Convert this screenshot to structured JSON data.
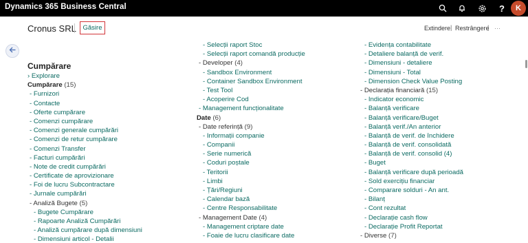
{
  "app": {
    "title": "Dynamics 365 Business Central",
    "avatar_initial": "K"
  },
  "topbar_icons": [
    "search-icon",
    "bell-icon",
    "gear-icon",
    "help-icon"
  ],
  "header": {
    "company": "Cronus SRL",
    "find_label": "Găsire",
    "expand_label": "Extindere",
    "collapse_label": "Restrângere",
    "more_label": "···",
    "separator": "|"
  },
  "colors": {
    "accent": "#0b6a62",
    "highlight_border": "#d13438",
    "topbar": "#000000",
    "avatar": "#c64b2c"
  },
  "col1": {
    "heading": "Cumpărare",
    "explore": "Explorare",
    "rows": [
      {
        "t": "Cumpărare",
        "c": " (15)",
        "k": "hdr",
        "i": 0
      },
      {
        "t": "- Furnizori",
        "k": "link",
        "i": 0
      },
      {
        "t": "- Contacte",
        "k": "link",
        "i": 0
      },
      {
        "t": "- Oferte cumpărare",
        "k": "link",
        "i": 0
      },
      {
        "t": "- Comenzi cumpărare",
        "k": "link",
        "i": 0
      },
      {
        "t": "- Comenzi generale cumpărări",
        "k": "link",
        "i": 0
      },
      {
        "t": "- Comenzi de retur cumpărare",
        "k": "link",
        "i": 0
      },
      {
        "t": "- Comenzi Transfer",
        "k": "link",
        "i": 0
      },
      {
        "t": "- Facturi cumpărări",
        "k": "link",
        "i": 0
      },
      {
        "t": "- Note de credit cumpărări",
        "k": "link",
        "i": 0
      },
      {
        "t": "- Certificate de aprovizionare",
        "k": "link",
        "i": 0
      },
      {
        "t": "- Foi de lucru Subcontractare",
        "k": "link",
        "i": 0
      },
      {
        "t": "- Jurnale cumpărări",
        "k": "link",
        "i": 0
      },
      {
        "t": "- Analiză Bugete",
        "c": " (5)",
        "k": "cat",
        "i": 0
      },
      {
        "t": "- Bugete Cumpărare",
        "k": "link",
        "i": 1
      },
      {
        "t": "- Rapoarte Analiză Cumpărări",
        "k": "link",
        "i": 1
      },
      {
        "t": "- Analiză cumpărare după dimensiuni",
        "k": "link",
        "i": 1
      },
      {
        "t": "- Dimensiuni articol - Detalii",
        "k": "link",
        "i": 1
      }
    ]
  },
  "col2": {
    "rows": [
      {
        "t": "- Selecții raport Stoc",
        "k": "link",
        "i": 1
      },
      {
        "t": "- Selecții raport comandă producție",
        "k": "link",
        "i": 1
      },
      {
        "t": "- Developer",
        "c": " (4)",
        "k": "cat",
        "i": 0
      },
      {
        "t": "- Sandbox Environment",
        "k": "link",
        "i": 1
      },
      {
        "t": "- Container Sandbox Environment",
        "k": "link",
        "i": 1
      },
      {
        "t": "- Test Tool",
        "k": "link",
        "i": 1
      },
      {
        "t": "- Acoperire Cod",
        "k": "link",
        "i": 1
      },
      {
        "t": "- Management funcționalitate",
        "k": "link",
        "i": 0
      },
      {
        "t": "Date",
        "c": " (6)",
        "k": "hdr",
        "i": 0
      },
      {
        "t": "- Date referință",
        "c": " (9)",
        "k": "cat",
        "i": 0
      },
      {
        "t": "- Informații companie",
        "k": "link",
        "i": 1
      },
      {
        "t": "- Companii",
        "k": "link",
        "i": 1
      },
      {
        "t": "- Serie numerică",
        "k": "link",
        "i": 1
      },
      {
        "t": "- Coduri poștale",
        "k": "link",
        "i": 1
      },
      {
        "t": "- Teritorii",
        "k": "link",
        "i": 1
      },
      {
        "t": "- Limbi",
        "k": "link",
        "i": 1
      },
      {
        "t": "- Țări/Regiuni",
        "k": "link",
        "i": 1
      },
      {
        "t": "- Calendar bază",
        "k": "link",
        "i": 1
      },
      {
        "t": "- Centre Responsabilitate",
        "k": "link",
        "i": 1
      },
      {
        "t": "- Management Date",
        "c": " (4)",
        "k": "cat",
        "i": 0
      },
      {
        "t": "- Management criptare date",
        "k": "link",
        "i": 1
      },
      {
        "t": "- Foaie de lucru clasificare date",
        "k": "link",
        "i": 1
      }
    ]
  },
  "col3": {
    "rows": [
      {
        "t": "- Evidența contabilitate",
        "k": "link",
        "i": 1
      },
      {
        "t": "- Detaliere balanță de verif.",
        "k": "link",
        "i": 1
      },
      {
        "t": "- Dimensiuni - detaliere",
        "k": "link",
        "i": 1
      },
      {
        "t": "- Dimensiuni - Total",
        "k": "link",
        "i": 1
      },
      {
        "t": "- Dimension Check Value Posting",
        "k": "link",
        "i": 1
      },
      {
        "t": "- Declarația financiară",
        "c": " (15)",
        "k": "cat",
        "i": 0
      },
      {
        "t": "- Indicator economic",
        "k": "link",
        "i": 1
      },
      {
        "t": "- Balanță verificare",
        "k": "link",
        "i": 1
      },
      {
        "t": "- Balanță verificare/Buget",
        "k": "link",
        "i": 1
      },
      {
        "t": "- Balanță verif./An anterior",
        "k": "link",
        "i": 1
      },
      {
        "t": "- Balanță de verif. de închidere",
        "k": "link",
        "i": 1
      },
      {
        "t": "- Balanță de verif. consolidată",
        "k": "link",
        "i": 1
      },
      {
        "t": "- Balanță de verif. consolid (4)",
        "k": "link",
        "i": 1
      },
      {
        "t": "- Buget",
        "k": "link",
        "i": 1
      },
      {
        "t": "- Balanță verificare după perioadă",
        "k": "link",
        "i": 1
      },
      {
        "t": "- Sold exercițiu financiar",
        "k": "link",
        "i": 1
      },
      {
        "t": "- Comparare solduri - An ant.",
        "k": "link",
        "i": 1
      },
      {
        "t": "- Bilanț",
        "k": "link",
        "i": 1
      },
      {
        "t": "- Cont rezultat",
        "k": "link",
        "i": 1
      },
      {
        "t": "- Declarație cash flow",
        "k": "link",
        "i": 1
      },
      {
        "t": "- Declarație Profit Reportat",
        "k": "link",
        "i": 1
      },
      {
        "t": "- Diverse",
        "c": " (7)",
        "k": "cat",
        "i": 0
      }
    ]
  }
}
